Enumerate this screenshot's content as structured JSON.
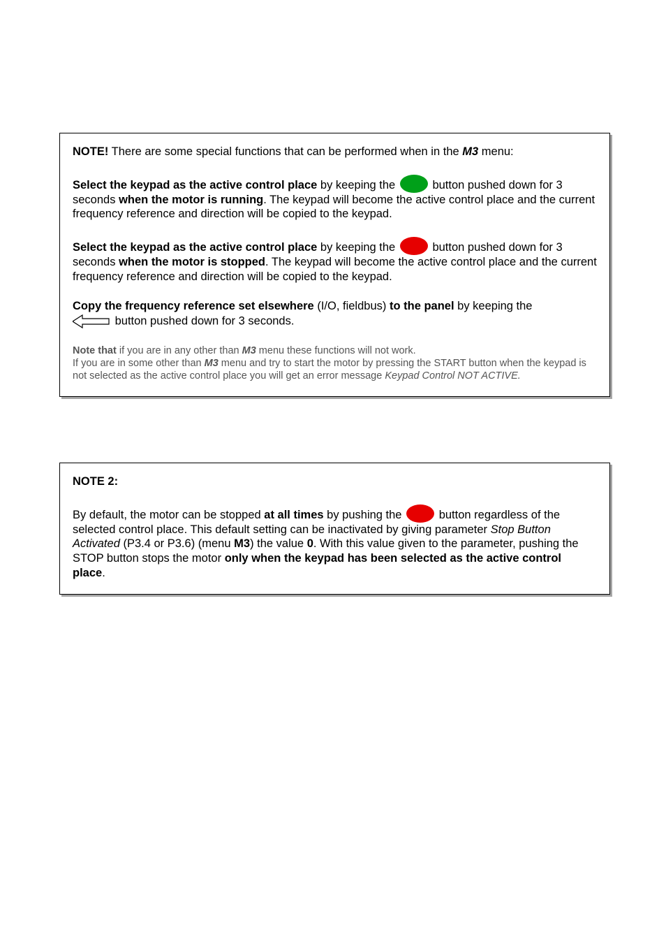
{
  "box1": {
    "headline_bold": "NOTE!",
    "headline_text": "There are some special functions that can be performed when in the",
    "headline_m3": "M3",
    "headline_tail": "menu:",
    "p1_a_bold": "Select the keypad as the active control place",
    "p1_a_text": "by keeping the",
    "p1_b_text": "button pushed down for 3 seconds",
    "p1_b_bold": "when the motor is running",
    "p1_c_text": ". The keypad will become the active control place and the current frequency reference and direction will be copied to the keypad.",
    "p2_a_bold": "Select the keypad as the active control place",
    "p2_a_text": "by keeping the",
    "p2_b_text": "button pushed down for 3 seconds",
    "p2_b_bold": "when the motor is stopped",
    "p2_c_text": ". The keypad will become the active control place and the current frequency reference and direction will be copied to the keypad.",
    "p3_a_bold": "Copy the frequency reference set elsewhere",
    "p3_a_mid": "(I/O, fieldbus)",
    "p3_a_bold2": "to the panel",
    "p3_a_tail": "by keeping the",
    "p3_b_text": "button pushed down for 3 seconds.",
    "p4_a_bold": "Note that",
    "p4_a_text": "if you are in any other than",
    "p4_a_m3": "M3",
    "p4_a_tail": "menu these functions will not work.",
    "p4_b_text_pre": "If you are in some other than",
    "p4_b_m3": "M3",
    "p4_b_text_mid": "menu and try to start the motor by pressing the START button when the keypad is not selected as the active control place you will get an error message",
    "p4_b_ital": "Keypad Control NOT ACTIVE.",
    "icons": {
      "green": "start-button-icon",
      "red": "stop-button-icon",
      "arrow": "left-arrow-button-icon"
    }
  },
  "box2": {
    "title": "NOTE 2:",
    "p1_a": "By default, the motor can be stopped",
    "p1_bold_times": "at all times",
    "p1_b": "by pushing the",
    "p1_c": "button regardless of the selected control place. This default setting can be inactivated by giving parameter",
    "p1_ital_param": "Stop Button Activated",
    "p1_d": "(P3.4 or P3.6) (menu",
    "p1_bold_menu": "M3",
    "p1_e": ") the value",
    "p1_bold_zero": "0",
    "p1_f": ". With this value given to the parameter, pushing the STOP button stops the motor",
    "p1_bold_tail": "only when the keypad has been selected as the active control place",
    "p1_g": "."
  }
}
